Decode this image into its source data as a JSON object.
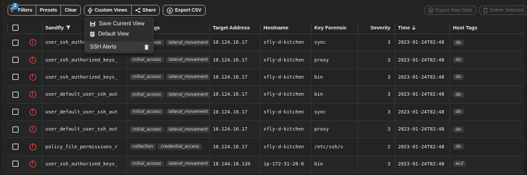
{
  "toolbar": {
    "filters_label": "Filters",
    "filters_badge": "2",
    "presets_label": "Presets",
    "clear_label": "Clear",
    "custom_views_label": "Custom Views",
    "share_label": "Share",
    "export_csv_label": "Export CSV",
    "export_raw_label": "Export Raw Data",
    "delete_selected_label": "Delete Selected"
  },
  "custom_views_menu": {
    "save_label": "Save Current View",
    "default_label": "Default View",
    "views": [
      {
        "label": "SSH Alerts"
      }
    ]
  },
  "table": {
    "headers": {
      "name": "Sandfly",
      "tags": "Tags",
      "target": "Target Address",
      "hostname": "Hostname",
      "key": "Key Forensic",
      "severity": "Severity",
      "time": "Time",
      "host_tags": "Host Tags"
    },
    "rows": [
      {
        "name": "user_ssh_authorized_keys_",
        "tags": [
          "initial_access",
          "lateral_movement"
        ],
        "ip": "10.124.16.17",
        "host": "sfly-d-kitchen",
        "key": "sync",
        "sev": "3",
        "time": "2023-01-24T02:48",
        "host_tag": "do"
      },
      {
        "name": "user_ssh_authorized_keys_",
        "tags": [
          "initial_access",
          "lateral_movement"
        ],
        "ip": "10.124.16.17",
        "host": "sfly-d-kitchen",
        "key": "proxy",
        "sev": "3",
        "time": "2023-01-24T02:48",
        "host_tag": "do"
      },
      {
        "name": "user_ssh_authorized_keys_",
        "tags": [
          "initial_access",
          "lateral_movement"
        ],
        "ip": "10.124.16.17",
        "host": "sfly-d-kitchen",
        "key": "bin",
        "sev": "3",
        "time": "2023-01-24T02:48",
        "host_tag": "do"
      },
      {
        "name": "user_default_user_ssh_aut",
        "tags": [
          "initial_access",
          "lateral_movement"
        ],
        "ip": "10.124.16.17",
        "host": "sfly-d-kitchen",
        "key": "bin",
        "sev": "3",
        "time": "2023-01-24T02:48",
        "host_tag": "do"
      },
      {
        "name": "user_default_user_ssh_aut",
        "tags": [
          "initial_access",
          "lateral_movement"
        ],
        "ip": "10.124.16.17",
        "host": "sfly-d-kitchen",
        "key": "sync",
        "sev": "3",
        "time": "2023-01-24T02:48",
        "host_tag": "do"
      },
      {
        "name": "user_default_user_ssh_aut",
        "tags": [
          "initial_access",
          "lateral_movement"
        ],
        "ip": "10.124.16.17",
        "host": "sfly-d-kitchen",
        "key": "proxy",
        "sev": "3",
        "time": "2023-01-24T02:48",
        "host_tag": "do"
      },
      {
        "name": "policy_file_permissions_r",
        "tags": [
          "collection",
          "credential_access"
        ],
        "ip": "10.124.16.17",
        "host": "sfly-d-kitchen",
        "key": "/etc/ssh/s",
        "sev": "2",
        "time": "2023-01-24T02:48",
        "host_tag": "do"
      },
      {
        "name": "user_ssh_authorized_keys_",
        "tags": [
          "initial_access",
          "lateral_movement"
        ],
        "ip": "18.144.18.139",
        "host": "ip-172-31-20-6",
        "key": "bin",
        "sev": "3",
        "time": "2023-01-24T02:48",
        "host_tag": "ec2"
      }
    ]
  },
  "colors": {
    "accent": "#2a8fd6",
    "alert": "#e84545",
    "background": "#232323"
  }
}
